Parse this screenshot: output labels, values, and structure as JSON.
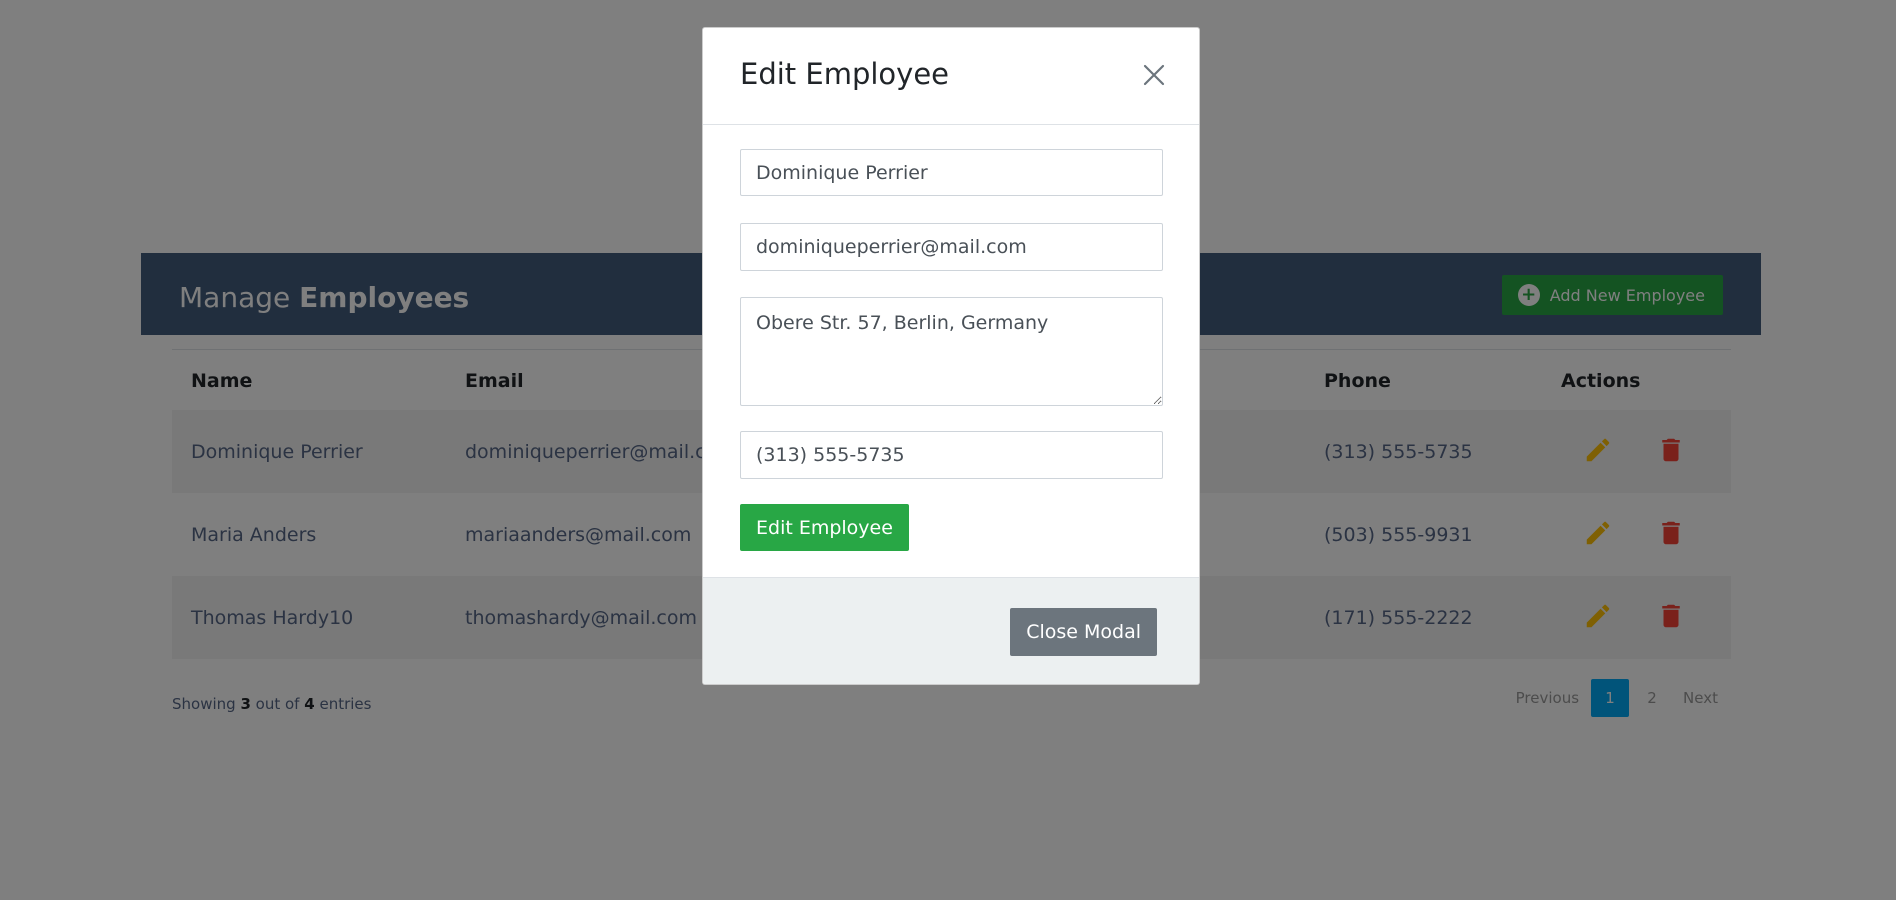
{
  "card": {
    "title_prefix": "Manage",
    "title_bold": "Employees",
    "add_button": "Add New Employee"
  },
  "table": {
    "headers": {
      "name": "Name",
      "email": "Email",
      "phone": "Phone",
      "actions": "Actions"
    },
    "rows": [
      {
        "name": "Dominique Perrier",
        "email": "dominiqueperrier@mail.com",
        "phone": "(313) 555-5735"
      },
      {
        "name": "Maria Anders",
        "email": "mariaanders@mail.com",
        "phone": "(503) 555-9931"
      },
      {
        "name": "Thomas Hardy10",
        "email": "thomashardy@mail.com",
        "phone": "(171) 555-2222"
      }
    ]
  },
  "footer": {
    "showing": "Showing",
    "shown_count": "3",
    "out_of": "out of",
    "total_count": "4",
    "entries": "entries"
  },
  "pagination": {
    "previous": "Previous",
    "pages": [
      "1",
      "2"
    ],
    "active_page": "1",
    "next": "Next"
  },
  "modal": {
    "title": "Edit Employee",
    "name_value": "Dominique Perrier",
    "email_value": "dominiqueperrier@mail.com",
    "address_value": "Obere Str. 57, Berlin, Germany",
    "phone_value": "(313) 555-5735",
    "submit_label": "Edit Employee",
    "close_label": "Close Modal"
  },
  "colors": {
    "header_bg": "#435d7d",
    "success": "#28a745",
    "edit_icon": "#ffc107",
    "delete_icon": "#f44336",
    "active_page": "#03a9f4",
    "secondary": "#6c757d"
  }
}
